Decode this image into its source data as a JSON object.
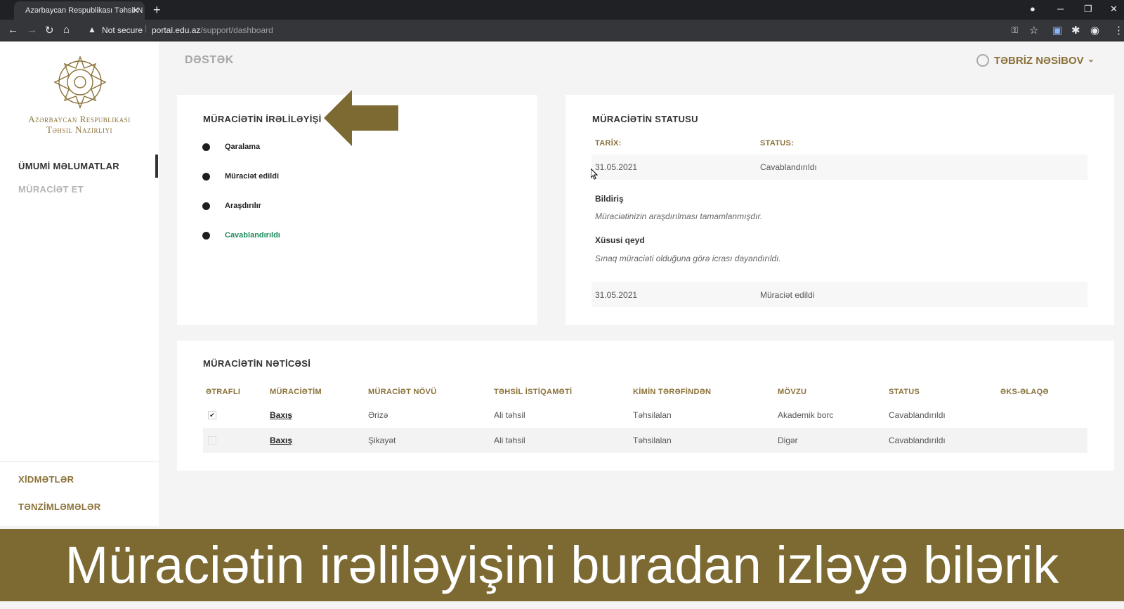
{
  "browser": {
    "tab_title": "Azərbaycan Respublikası Təhsil N",
    "tab_close": "✕",
    "new_tab": "+",
    "security_label": "Not secure",
    "url_host": "portal.edu.az",
    "url_path": "/support/dashboard"
  },
  "sidebar": {
    "ministry_line1": "Azərbaycan Respublikası",
    "ministry_line2": "Təhsil Nazirliyi",
    "nav_general": "ÜMUMİ MƏLUMATLAR",
    "nav_apply": "MÜRACİƏT ET",
    "nav_services": "XİDMƏTLƏR",
    "nav_settings": "TƏNZİMLƏMƏLƏR"
  },
  "header": {
    "title": "DƏSTƏK",
    "user_name": "TƏBRİZ NƏSİBOV"
  },
  "progress": {
    "title": "MÜRACİƏTİN İRƏLİLƏYİŞİ",
    "steps": [
      {
        "label": "Qaralama"
      },
      {
        "label": "Müraciət edildi"
      },
      {
        "label": "Araşdırılır"
      },
      {
        "label": "Cavablandırıldı"
      }
    ]
  },
  "status": {
    "title": "MÜRACİƏTİN STATUSU",
    "col_date": "TARİX:",
    "col_status": "STATUS:",
    "rows": [
      {
        "date": "31.05.2021",
        "status": "Cavablandırıldı"
      },
      {
        "date": "31.05.2021",
        "status": "Müraciət edildi"
      }
    ],
    "notice_label": "Bildiriş",
    "notice_text": "Müraciətinizin araşdırılması tamamlanmışdır.",
    "special_label": "Xüsusi qeyd",
    "special_text": "Sınaq müraciəti olduğuna görə icrası dayandırıldı."
  },
  "result": {
    "title": "MÜRACİƏTİN NƏTİCƏSİ",
    "columns": [
      "ƏTRAFLI",
      "MÜRACİƏTİM",
      "MÜRACİƏT NÖVÜ",
      "TƏHSİL İSTİQAMƏTİ",
      "KİMİN TƏRƏFİNDƏN",
      "MÖVZU",
      "STATUS",
      "ƏKS-ƏLAQƏ"
    ],
    "rows": [
      {
        "checked": "✔",
        "link": "Baxış",
        "type": "Ərizə",
        "direction": "Ali təhsil",
        "by": "Təhsilalan",
        "topic": "Akademik borc",
        "status": "Cavablandırıldı"
      },
      {
        "checked": "",
        "link": "Baxış",
        "type": "Şikayət",
        "direction": "Ali təhsil",
        "by": "Təhsilalan",
        "topic": "Digər",
        "status": "Cavablandırıldı"
      }
    ]
  },
  "subtitle": "Müraciətin irəliləyişini buradan izləyə bilərik",
  "colors": {
    "brand_gold": "#8a7138",
    "banner": "#7c6a32",
    "done_green": "#1e8c5c"
  }
}
